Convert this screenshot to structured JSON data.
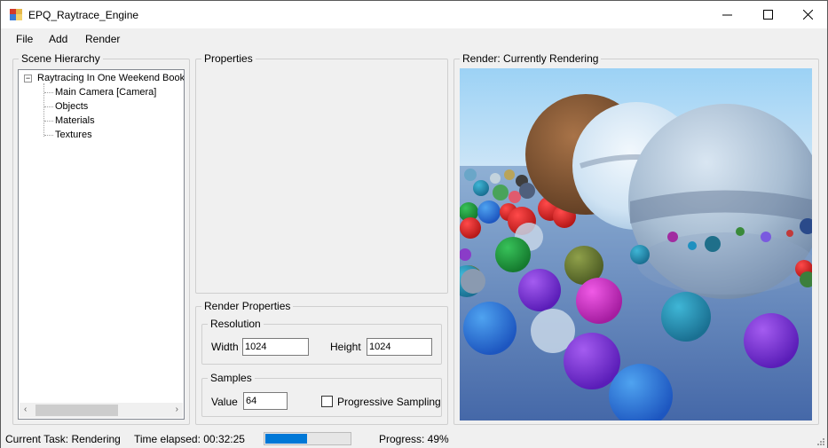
{
  "window": {
    "title": "EPQ_Raytrace_Engine"
  },
  "window_controls": {
    "minimize": "—",
    "maximize": "☐",
    "close": "✕"
  },
  "menu": [
    "File",
    "Add",
    "Render"
  ],
  "scene_hierarchy": {
    "label": "Scene Hierarchy",
    "root": {
      "label": "Raytracing In One Weekend Book",
      "expanded": true,
      "toggle": "−"
    },
    "children": [
      "Main Camera [Camera]",
      "Objects",
      "Materials",
      "Textures"
    ],
    "scroll": {
      "left_arrow": "‹",
      "right_arrow": "›"
    }
  },
  "properties": {
    "label": "Properties"
  },
  "render_properties": {
    "label": "Render Properties",
    "resolution": {
      "label": "Resolution",
      "width_label": "Width",
      "width_value": "1024",
      "height_label": "Height",
      "height_value": "1024"
    },
    "samples": {
      "label": "Samples",
      "value_label": "Value",
      "value": "64",
      "progressive_label": "Progressive Sampling",
      "progressive_checked": false
    }
  },
  "render_panel": {
    "label": "Render: Currently Rendering"
  },
  "status": {
    "task": "Current Task: Rendering",
    "time": "Time elapsed: 00:32:25",
    "progress_value": 0.49,
    "progress_text": "Progress: 49%"
  },
  "colors": {
    "accent": "#0078d7",
    "sky_top": "#9cd2f5",
    "ground": "#4a73b0"
  }
}
